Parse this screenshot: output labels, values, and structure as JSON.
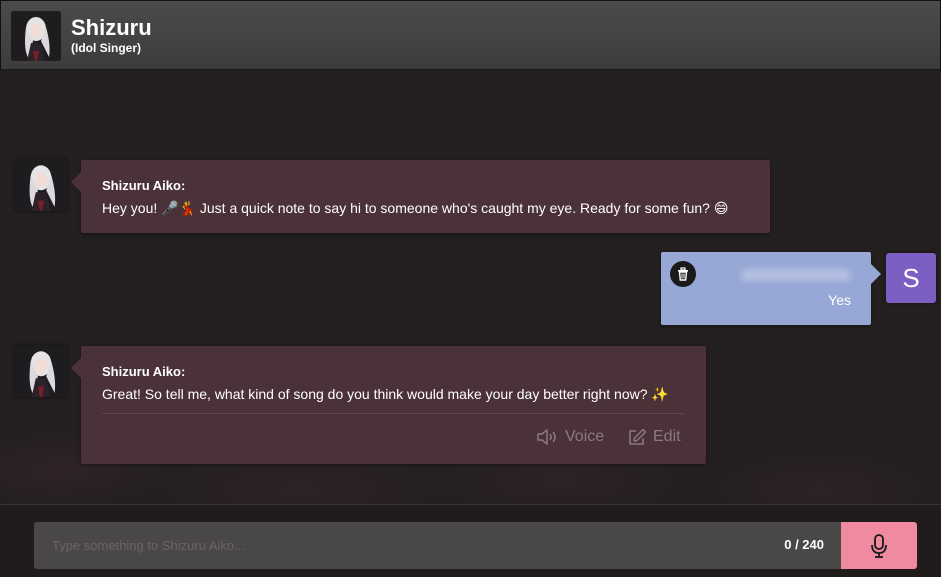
{
  "header": {
    "name": "Shizuru",
    "subtitle": "(Idol Singer)"
  },
  "messages": [
    {
      "role": "bot",
      "sender": "Shizuru Aiko:",
      "text": "Hey you! 🎤💃 Just a quick note to say hi to someone who's caught my eye. Ready for some fun? 😄"
    },
    {
      "role": "user",
      "text": "Yes",
      "avatar_letter": "S"
    },
    {
      "role": "bot",
      "sender": "Shizuru Aiko:",
      "text": "Great! So tell me, what kind of song do you think would make your day better right now? ✨",
      "actions": {
        "voice_label": "Voice",
        "edit_label": "Edit"
      }
    }
  ],
  "input": {
    "placeholder": "Type something to Shizuru Aiko...",
    "value": "",
    "char_count": "0 / 240"
  },
  "colors": {
    "bot_bubble": "#4b3138",
    "user_bubble": "#98a8d6",
    "user_avatar": "#7d5ec2",
    "mic_button": "#f08aa0",
    "header": "#444444"
  },
  "icons": {
    "delete": "trash-icon",
    "voice": "speaker-icon",
    "edit": "edit-icon",
    "mic": "microphone-icon"
  }
}
